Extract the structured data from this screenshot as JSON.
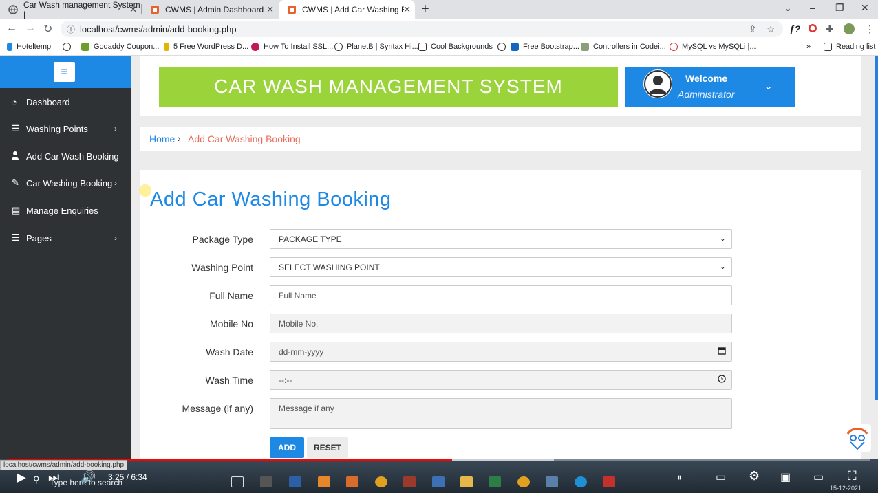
{
  "browser": {
    "tabs": [
      {
        "title": "Car Wash management System |",
        "active": false
      },
      {
        "title": "CWMS | Admin Dashboard",
        "active": false
      },
      {
        "title": "CWMS | Add Car Washing Bookin",
        "active": true
      }
    ],
    "url": "localhost/cwms/admin/add-booking.php",
    "bookmarks": [
      "Hoteltemp",
      "Godaddy Coupon...",
      "5 Free WordPress D...",
      "How To Install SSL...",
      "PlanetB | Syntax Hi...",
      "Cool Backgrounds",
      "Free Bootstrap...",
      "Controllers in Codei...",
      "MySQL vs MySQLi |..."
    ],
    "more_bookmarks": "»",
    "reading_list": "Reading list"
  },
  "sidebar": {
    "items": [
      {
        "label": "Dashboard",
        "icon": "dashboard-icon",
        "has_sub": false
      },
      {
        "label": "Washing Points",
        "icon": "list-icon",
        "has_sub": true
      },
      {
        "label": "Add Car Wash Booking",
        "icon": "user-icon",
        "has_sub": false
      },
      {
        "label": "Car Washing Booking",
        "icon": "edit-icon",
        "has_sub": true
      },
      {
        "label": "Manage Enquiries",
        "icon": "file-icon",
        "has_sub": false
      },
      {
        "label": "Pages",
        "icon": "list-icon",
        "has_sub": true
      }
    ]
  },
  "header": {
    "banner": "CAR WASH MANAGEMENT SYSTEM",
    "welcome": "Welcome",
    "role": "Administrator"
  },
  "breadcrumb": {
    "home": "Home",
    "current": "Add Car Washing Booking"
  },
  "form": {
    "title": "Add Car Washing Booking",
    "fields": {
      "package_type": {
        "label": "Package Type",
        "value": "PACKAGE TYPE"
      },
      "washing_point": {
        "label": "Washing Point",
        "value": "SELECT WASHING POINT"
      },
      "full_name": {
        "label": "Full Name",
        "placeholder": "Full Name"
      },
      "mobile": {
        "label": "Mobile No",
        "placeholder": "Mobile No."
      },
      "wash_date": {
        "label": "Wash Date",
        "placeholder": "dd-mm-yyyy"
      },
      "wash_time": {
        "label": "Wash Time",
        "placeholder": "--:--"
      },
      "message": {
        "label": "Message (if any)",
        "placeholder": "Message if any"
      }
    },
    "add_label": "ADD",
    "reset_label": "RESET"
  },
  "video": {
    "time": "3:25 / 6:34",
    "status_url": "localhost/cwms/admin/add-booking.php",
    "progress_fraction": 0.515,
    "buffered_fraction": 0.633
  },
  "taskbar": {
    "search_placeholder": "Type here to search",
    "date": "15-12-2021"
  },
  "colors": {
    "accent": "#1e88e5",
    "banner": "#9ad33a",
    "sidebar": "#2f3234",
    "crumb_current": "#e86c5a"
  }
}
